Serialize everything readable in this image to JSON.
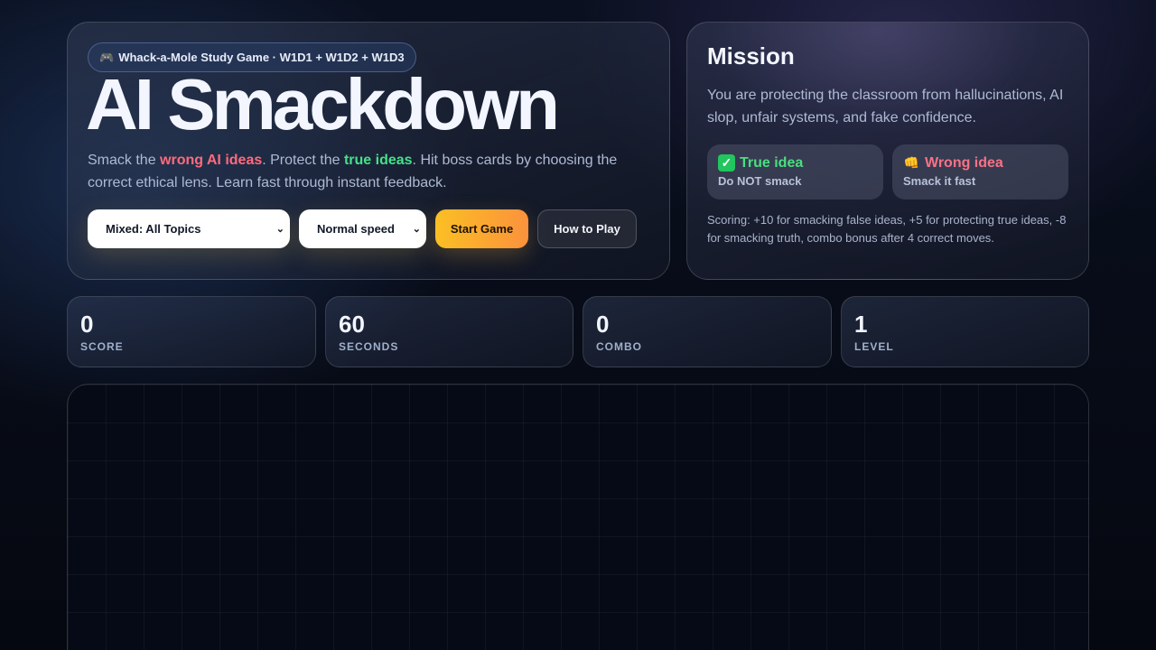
{
  "hero": {
    "tag_label": "Whack-a-Mole Study Game · W1D1 + W1D2 + W1D3",
    "tag_icon": "gamepad-icon",
    "title": "AI Smackdown",
    "lead": {
      "p1": "Smack the ",
      "bad": "wrong AI ideas",
      "p2": ". Protect the ",
      "good": "true ideas",
      "p3": ". Hit boss cards by choosing the correct ethical lens. Learn fast through instant feedback."
    },
    "controls": {
      "topic": "Mixed: All Topics",
      "speed": "Normal speed",
      "start_label": "Start Game",
      "how_label": "How to Play"
    }
  },
  "mission": {
    "title": "Mission",
    "text": "You are protecting the classroom from hallucinations, AI slop, unfair systems, and fake confidence.",
    "true_idea": {
      "head": "True idea",
      "sub": "Do NOT smack",
      "icon": "check-icon"
    },
    "wrong_idea": {
      "head": "Wrong idea",
      "sub": "Smack it fast",
      "icon": "fist-icon"
    },
    "scoring": "Scoring: +10 for smacking false ideas, +5 for protecting true ideas, -8 for smacking truth, combo bonus after 4 correct moves."
  },
  "stats": {
    "score": {
      "value": "0",
      "label": "SCORE"
    },
    "seconds": {
      "value": "60",
      "label": "SECONDS"
    },
    "combo": {
      "value": "0",
      "label": "COMBO"
    },
    "level": {
      "value": "1",
      "label": "LEVEL"
    }
  },
  "colors": {
    "wrong": "#ff6b7d",
    "true": "#45e08a",
    "start_gradient": [
      "#fbbf24",
      "#fb923c"
    ]
  }
}
